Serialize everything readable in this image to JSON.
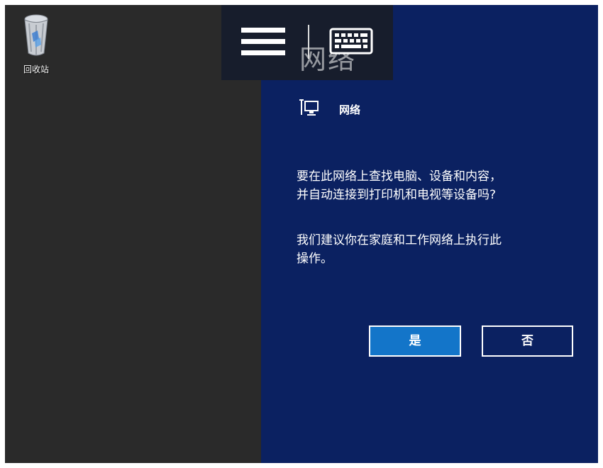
{
  "desktop": {
    "recycle_bin_label": "回收站"
  },
  "topbar": {
    "ghost_title": "网络",
    "menu_icon": "hamburger-menu-icon",
    "keyboard_icon": "keyboard-icon"
  },
  "network_panel": {
    "header_icon": "network-computer-icon",
    "title": "网络",
    "question_line1": "要在此网络上查找电脑、设备和内容，",
    "question_line2": "并自动连接到打印机和电视等设备吗?",
    "recommend_line1": "我们建议你在家庭和工作网络上执行此",
    "recommend_line2": "操作。",
    "yes_label": "是",
    "no_label": "否"
  },
  "colors": {
    "desktop_bg": "#2a2a2a",
    "panel_bg": "#0b2161",
    "topbar_bg": "#171d2c",
    "yes_button_bg": "#1375c9",
    "text": "#ffffff"
  }
}
